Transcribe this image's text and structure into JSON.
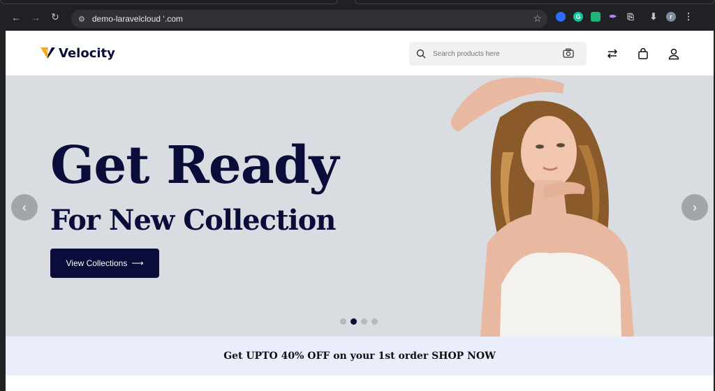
{
  "browser": {
    "url": "demo-laravelcloud       ‘.com",
    "nav_icons": [
      "back-icon",
      "forward-icon",
      "reload-icon"
    ],
    "extensions": [
      "ext-1",
      "grammarly",
      "ext-shield",
      "ext-feather",
      "extensions-icon",
      "download-icon",
      "profile-avatar"
    ],
    "profile_initial": "r"
  },
  "header": {
    "brand": "Velocity",
    "search_placeholder": "Search products here"
  },
  "hero": {
    "title": "Get Ready",
    "subtitle": "For New Collection",
    "button_label": "View Collections",
    "button_arrow": "⟶",
    "prev_arrow": "‹",
    "next_arrow": "›",
    "slides_total": 4,
    "slide_active": 2
  },
  "promo": {
    "text": "Get UPTO 40% OFF on your 1st order SHOP NOW"
  },
  "colors": {
    "brand_navy": "#0a0c3a",
    "hero_bg": "#d9dde2",
    "promo_bg": "#eaedfb",
    "logo_orange": "#f5a623"
  }
}
